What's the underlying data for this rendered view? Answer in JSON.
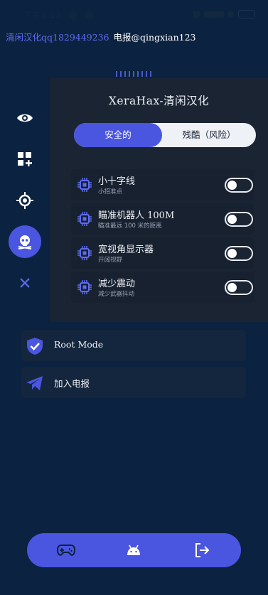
{
  "status_bar": {
    "time": "下午4:12",
    "icons": [
      "mute-icon",
      "alarm-icon",
      "wifi-icon",
      "signal-icon",
      "battery-icon"
    ]
  },
  "banner": {
    "left": "清闲汉化qq1829449236",
    "right": "电报@qingxian123"
  },
  "side_rail": {
    "items": [
      "eye-icon",
      "add-widget-icon",
      "target-icon",
      "skull-icon",
      "close-icon"
    ],
    "active": "skull-icon"
  },
  "panel": {
    "title": "XeraHax-清闲汉化",
    "tabs": [
      {
        "label": "安全的",
        "active": true
      },
      {
        "label": "残酷（风险）",
        "active": false
      }
    ],
    "options": [
      {
        "label": "小十字线",
        "sub": "小招准点",
        "enabled": false
      },
      {
        "label": "瞄准机器人 100M",
        "sub": "瞄准最远 100 米的距离",
        "enabled": false
      },
      {
        "label": "宽视角显示器",
        "sub": "开阔视野",
        "enabled": false
      },
      {
        "label": "减少震动",
        "sub": "减少武器抖动",
        "enabled": false
      }
    ]
  },
  "cards": [
    {
      "label": "Root Mode",
      "icon": "shield-check-icon"
    },
    {
      "label": "加入电报",
      "icon": "telegram-icon"
    }
  ],
  "dock": {
    "items": [
      "gamepad-icon",
      "android-icon",
      "logout-icon"
    ]
  },
  "colors": {
    "background": "#0b2240",
    "panel": "#1a2433",
    "accent": "#4a55e0",
    "text": "#eef1f6"
  }
}
